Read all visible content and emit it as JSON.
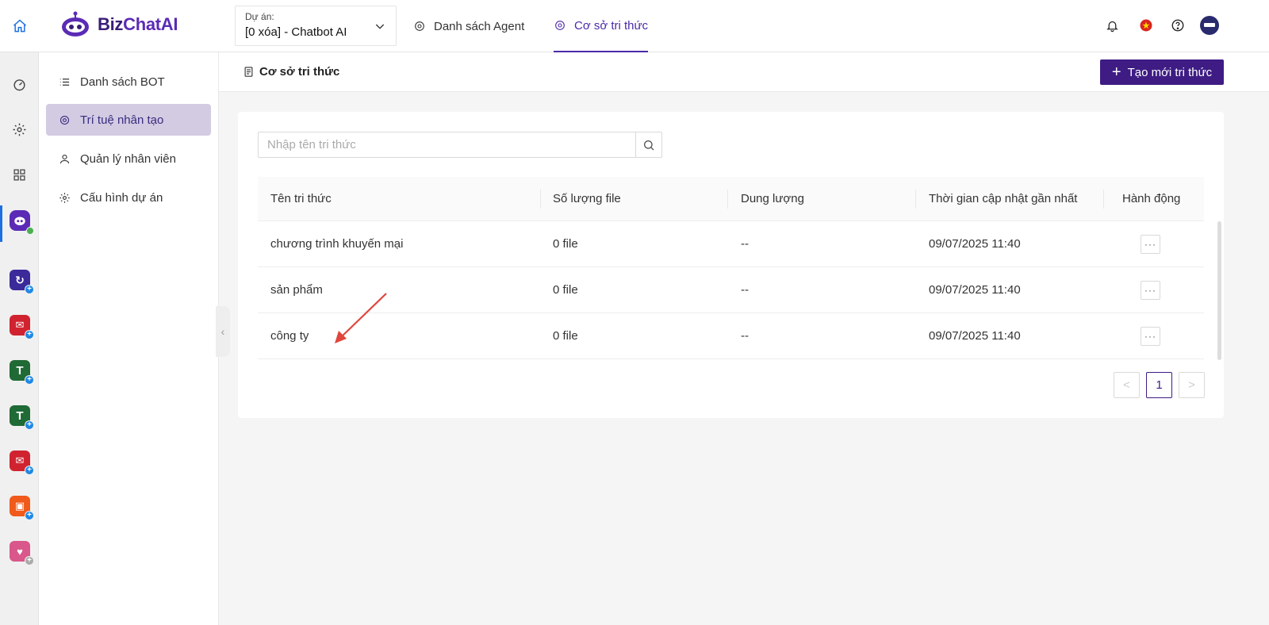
{
  "header": {
    "brand": {
      "part1": "Biz",
      "part2": "ChatAI"
    },
    "project": {
      "label": "Dự án:",
      "value": "[0 xóa] - Chatbot AI"
    },
    "tabs": [
      {
        "label": "Danh sách Agent",
        "active": false
      },
      {
        "label": "Cơ sở tri thức",
        "active": true
      }
    ],
    "icons": [
      "bell-icon",
      "vietnam-flag-icon",
      "help-icon",
      "user-avatar"
    ]
  },
  "sidebar": {
    "items": [
      {
        "label": "Danh sách BOT",
        "icon": "list-icon",
        "active": false
      },
      {
        "label": "Trí tuệ nhân tạo",
        "icon": "ai-icon",
        "active": true
      },
      {
        "label": "Quản lý nhân viên",
        "icon": "user-icon",
        "active": false
      },
      {
        "label": "Cấu hình dự án",
        "icon": "gear-icon",
        "active": false
      }
    ]
  },
  "content": {
    "title": "Cơ sở tri thức",
    "create_label": "Tạo mới tri thức",
    "search_placeholder": "Nhập tên tri thức",
    "columns": [
      "Tên tri thức",
      "Số lượng file",
      "Dung lượng",
      "Thời gian cập nhật gần nhất",
      "Hành động"
    ],
    "rows": [
      {
        "name": "chương trình khuyến mại",
        "files": "0 file",
        "size": "--",
        "updated": "09/07/2025 11:40"
      },
      {
        "name": "sản phẩm",
        "files": "0 file",
        "size": "--",
        "updated": "09/07/2025 11:40"
      },
      {
        "name": "công ty",
        "files": "0 file",
        "size": "--",
        "updated": "09/07/2025 11:40"
      }
    ],
    "pagination": {
      "prev": "<",
      "current": "1",
      "next": ">"
    }
  },
  "colors": {
    "brand": "#3e1c84",
    "accent": "#4b2aa8",
    "active_menu_bg": "#d3cbe2",
    "arrow": "#e0463c"
  }
}
